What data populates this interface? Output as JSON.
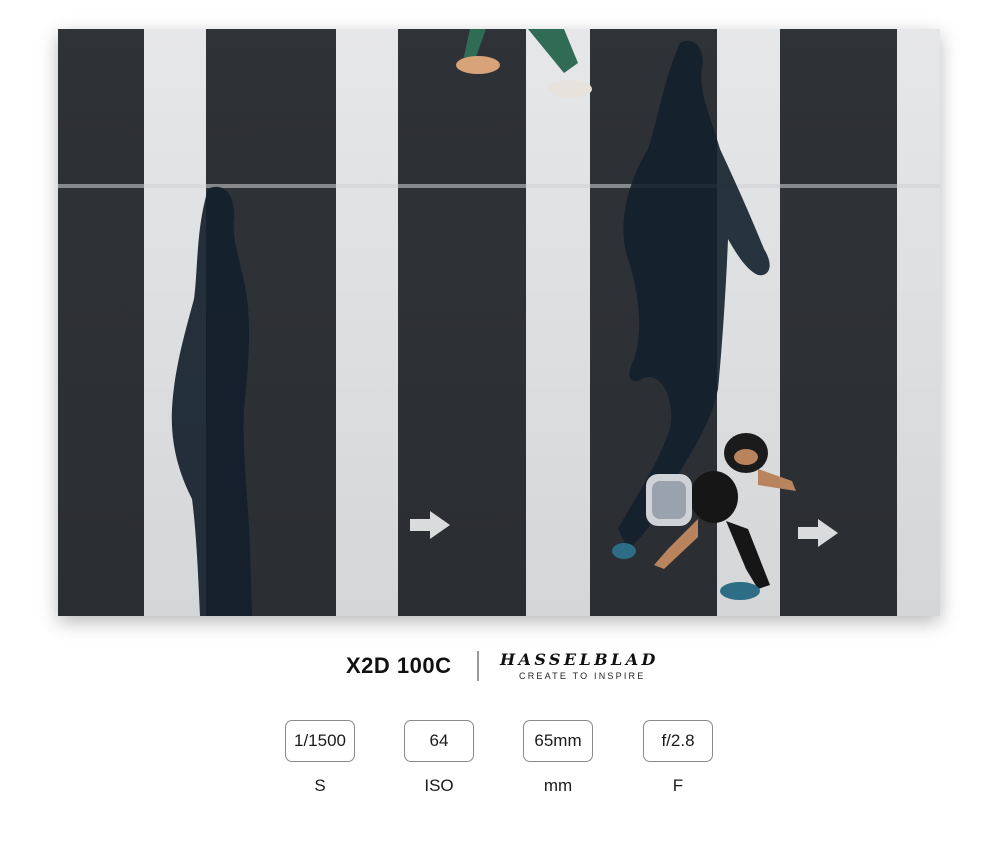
{
  "photo": {
    "subject": "overhead-crosswalk-pedestrians",
    "colors": {
      "asphalt": "#2b2e33",
      "stripe": "#dfe1e3",
      "shadow": "#14202a"
    }
  },
  "camera": {
    "model": "X2D 100C",
    "brand": "HASSELBLAD",
    "tagline": "CREATE TO INSPIRE"
  },
  "settings": [
    {
      "value": "1/1500",
      "label": "S"
    },
    {
      "value": "64",
      "label": "ISO"
    },
    {
      "value": "65mm",
      "label": "mm"
    },
    {
      "value": "f/2.8",
      "label": "F"
    }
  ]
}
